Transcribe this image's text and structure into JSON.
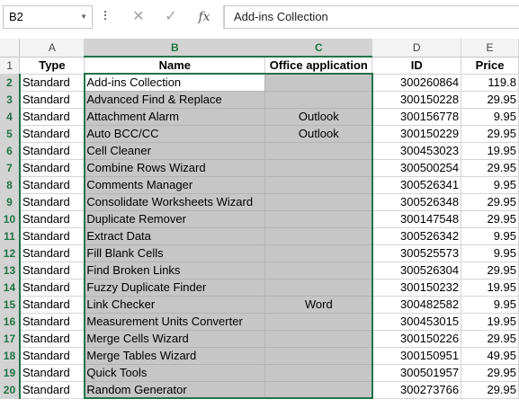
{
  "formula_bar": {
    "name_box": "B2",
    "formula": "Add-ins Collection",
    "cancel_icon": "✕",
    "enter_icon": "✓",
    "fx_label": "fx"
  },
  "columns": [
    "A",
    "B",
    "C",
    "D",
    "E"
  ],
  "header_row": {
    "row_number": "1",
    "type": "Type",
    "name": "Name",
    "office_application": "Office application",
    "id": "ID",
    "price": "Price"
  },
  "rows": [
    {
      "n": "2",
      "type": "Standard",
      "name": "Add-ins Collection",
      "app": "",
      "id": "300260864",
      "price": "119.8"
    },
    {
      "n": "3",
      "type": "Standard",
      "name": "Advanced Find & Replace",
      "app": "",
      "id": "300150228",
      "price": "29.95"
    },
    {
      "n": "4",
      "type": "Standard",
      "name": "Attachment Alarm",
      "app": "Outlook",
      "id": "300156778",
      "price": "9.95"
    },
    {
      "n": "5",
      "type": "Standard",
      "name": "Auto BCC/CC",
      "app": "Outlook",
      "id": "300150229",
      "price": "29.95"
    },
    {
      "n": "6",
      "type": "Standard",
      "name": "Cell Cleaner",
      "app": "",
      "id": "300453023",
      "price": "19.95"
    },
    {
      "n": "7",
      "type": "Standard",
      "name": "Combine Rows Wizard",
      "app": "",
      "id": "300500254",
      "price": "29.95"
    },
    {
      "n": "8",
      "type": "Standard",
      "name": "Comments Manager",
      "app": "",
      "id": "300526341",
      "price": "9.95"
    },
    {
      "n": "9",
      "type": "Standard",
      "name": "Consolidate Worksheets Wizard",
      "app": "",
      "id": "300526348",
      "price": "29.95"
    },
    {
      "n": "10",
      "type": "Standard",
      "name": "Duplicate Remover",
      "app": "",
      "id": "300147548",
      "price": "29.95"
    },
    {
      "n": "11",
      "type": "Standard",
      "name": "Extract Data",
      "app": "",
      "id": "300526342",
      "price": "9.95"
    },
    {
      "n": "12",
      "type": "Standard",
      "name": "Fill Blank Cells",
      "app": "",
      "id": "300525573",
      "price": "9.95"
    },
    {
      "n": "13",
      "type": "Standard",
      "name": "Find Broken Links",
      "app": "",
      "id": "300526304",
      "price": "29.95"
    },
    {
      "n": "14",
      "type": "Standard",
      "name": "Fuzzy Duplicate Finder",
      "app": "",
      "id": "300150232",
      "price": "19.95"
    },
    {
      "n": "15",
      "type": "Standard",
      "name": "Link Checker",
      "app": "Word",
      "id": "300482582",
      "price": "9.95"
    },
    {
      "n": "16",
      "type": "Standard",
      "name": "Measurement Units Converter",
      "app": "",
      "id": "300453015",
      "price": "19.95"
    },
    {
      "n": "17",
      "type": "Standard",
      "name": "Merge Cells Wizard",
      "app": "",
      "id": "300150226",
      "price": "29.95"
    },
    {
      "n": "18",
      "type": "Standard",
      "name": "Merge Tables Wizard",
      "app": "",
      "id": "300150951",
      "price": "49.95"
    },
    {
      "n": "19",
      "type": "Standard",
      "name": "Quick Tools",
      "app": "",
      "id": "300501957",
      "price": "29.95"
    },
    {
      "n": "20",
      "type": "Standard",
      "name": "Random Generator",
      "app": "",
      "id": "300273766",
      "price": "29.95"
    }
  ],
  "colors": {
    "selection_accent": "#217346",
    "selected_range_fill": "#c6c6c6",
    "header_fill": "#f3f3f3"
  }
}
